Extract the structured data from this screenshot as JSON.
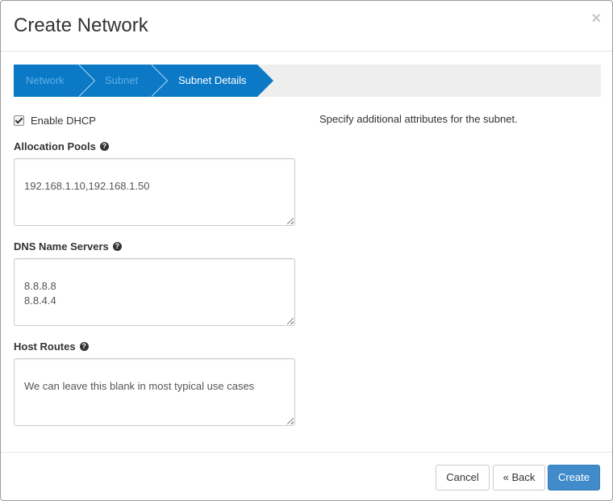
{
  "modal": {
    "title": "Create Network",
    "close_symbol": "×"
  },
  "wizard": {
    "steps": [
      {
        "label": "Network",
        "state": "done"
      },
      {
        "label": "Subnet",
        "state": "done"
      },
      {
        "label": "Subnet Details",
        "state": "active"
      }
    ]
  },
  "form": {
    "enable_dhcp": {
      "label": "Enable DHCP",
      "checked": true
    },
    "allocation_pools": {
      "label": "Allocation Pools",
      "value": "192.168.1.10,192.168.1.50",
      "help_icon": "question-circle-icon"
    },
    "dns_name_servers": {
      "label": "DNS Name Servers",
      "value": "8.8.8.8\n8.8.4.4",
      "help_icon": "question-circle-icon"
    },
    "host_routes": {
      "label": "Host Routes",
      "placeholder": "We can leave this blank in most typical use cases",
      "value": "",
      "help_icon": "question-circle-icon"
    }
  },
  "description": "Specify additional attributes for the subnet.",
  "footer": {
    "cancel_label": "Cancel",
    "back_label": "« Back",
    "create_label": "Create"
  },
  "colors": {
    "wizard_active": "#0b79c6",
    "wizard_track": "#eeeeee",
    "primary_button": "#428bca"
  }
}
